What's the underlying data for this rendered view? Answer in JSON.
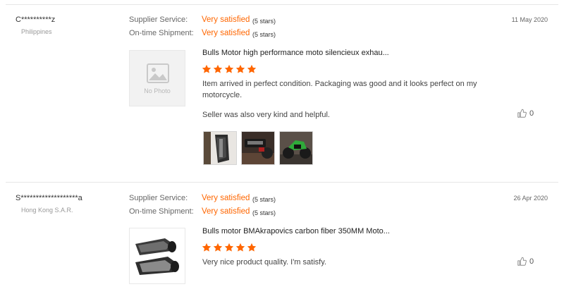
{
  "reviews": [
    {
      "buyer": "C**********z",
      "country": "Philippines",
      "date": "11 May 2020",
      "supplier_label": "Supplier Service:",
      "supplier_value": "Very satisfied",
      "supplier_stars": "(5 stars)",
      "shipment_label": "On-time Shipment:",
      "shipment_value": "Very satisfied",
      "shipment_stars": "(5 stars)",
      "thumb_text": "No Photo",
      "product_title": "Bulls Motor high performance moto silencieux exhau...",
      "rating": 5,
      "text": "Item arrived in perfect condition. Packaging was good and it looks perfect on my motorcycle.",
      "text2": "Seller was also very kind and helpful.",
      "likes": "0",
      "photos": [
        "exhaust-photo",
        "bike-photo",
        "green-bike-photo"
      ]
    },
    {
      "buyer": "S*******************a",
      "country": "Hong Kong S.A.R.",
      "date": "26 Apr 2020",
      "supplier_label": "Supplier Service:",
      "supplier_value": "Very satisfied",
      "supplier_stars": "(5 stars)",
      "shipment_label": "On-time Shipment:",
      "shipment_value": "Very satisfied",
      "shipment_stars": "(5 stars)",
      "product_title": "Bulls motor BMAkrapovics carbon fiber 350MM Moto...",
      "rating": 5,
      "text": "Very nice product quality. I'm satisfy.",
      "likes": "0"
    }
  ],
  "colors": {
    "accent": "#ff6600",
    "divider": "#e6e6e6"
  }
}
